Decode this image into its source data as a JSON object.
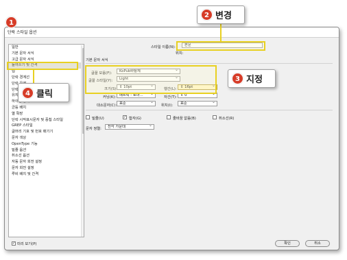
{
  "dialog": {
    "title": "단락 스타일 옵션"
  },
  "sidebar": {
    "items": [
      {
        "label": "일반"
      },
      {
        "label": "기본 문자 서식"
      },
      {
        "label": "고급 문자 서식"
      },
      {
        "label": "들여쓰기 및 간격"
      },
      {
        "label": "탭"
      },
      {
        "label": "단락 경계선"
      },
      {
        "label": "단락 음영"
      },
      {
        "label": "단락 배치"
      },
      {
        "label": "유지 옵션"
      },
      {
        "label": "하이픈 넣기"
      },
      {
        "label": "균등 배치"
      },
      {
        "label": "열 확장"
      },
      {
        "label": "단락 시작표시문자 및 중첩 스타일"
      },
      {
        "label": "GREP 스타일"
      },
      {
        "label": "글머리 기호 및 번호 매기기"
      },
      {
        "label": "문자 색상"
      },
      {
        "label": "OpenType 기능"
      },
      {
        "label": "밑줄 옵션"
      },
      {
        "label": "취소선 옵션"
      },
      {
        "label": "자동 문자 회전 설정"
      },
      {
        "label": "문자 회전 설정"
      },
      {
        "label": "루비 배치 및 간격"
      }
    ],
    "preview_label": "미리 보기(P)"
  },
  "main": {
    "style_name_label": "스타일 이름(N):",
    "style_name_value": "본문",
    "location_label": "위치:",
    "section_title": "기본 문자 서식",
    "font_family_label": "글꼴 모음(F):",
    "font_family_value": "KoPub바탕체",
    "font_style_label": "글꼴 스타일(Y):",
    "font_style_value": "Light",
    "size_label": "크기(S):",
    "size_value": "10pt",
    "leading_label": "행간(L):",
    "leading_value": "16pt",
    "kerning_label": "커닝(K):",
    "kerning_value": "메트릭 - 로마...",
    "tracking_label": "자간(T):",
    "tracking_value": "0",
    "case_label": "대소문자(C):",
    "case_value": "표준",
    "position_label": "위치(I):",
    "position_value": "표준",
    "underline_label": "밑줄(U)",
    "ligature_label": "합자(G)",
    "nobreak_label": "줄바꿈 없음(B)",
    "strike_label": "취소선(R)",
    "char_align_label": "문자 정렬:",
    "char_align_value": "전각 가운데"
  },
  "buttons": {
    "ok": "확인",
    "cancel": "취소"
  },
  "annotations": {
    "badge1": "1",
    "badge2": "2",
    "change_text": "변경",
    "badge3": "3",
    "specify_text": "지정",
    "badge4": "4",
    "click_text": "클릭"
  },
  "colors": {
    "highlight_border": "#e8d020",
    "badge_red": "#d63c28",
    "field_highlight": "#fff5c6"
  }
}
